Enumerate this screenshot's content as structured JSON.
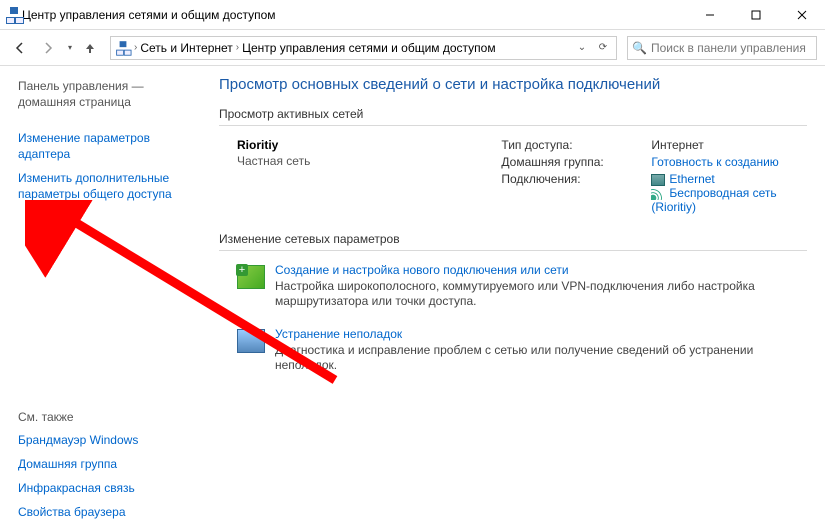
{
  "window": {
    "title": "Центр управления сетями и общим доступом"
  },
  "breadcrumb": {
    "level1": "Сеть и Интернет",
    "level2": "Центр управления сетями и общим доступом"
  },
  "search": {
    "placeholder": "Поиск в панели управления"
  },
  "sidebar": {
    "home": "Панель управления — домашняя страница",
    "adapter": "Изменение параметров адаптера",
    "advanced": "Изменить дополнительные параметры общего доступа",
    "seealso_label": "См. также",
    "seealso": {
      "firewall": "Брандмауэр Windows",
      "homegroup": "Домашняя группа",
      "infrared": "Инфракрасная связь",
      "browser": "Свойства браузера"
    }
  },
  "content": {
    "heading": "Просмотр основных сведений о сети и настройка подключений",
    "active_label": "Просмотр активных сетей",
    "network": {
      "name": "Rioritiy",
      "type": "Частная сеть",
      "access_label": "Тип доступа:",
      "access_value": "Интернет",
      "homegroup_label": "Домашняя группа:",
      "homegroup_value": "Готовность к созданию",
      "connections_label": "Подключения:",
      "conn_eth": "Ethernet",
      "conn_wifi": "Беспроводная сеть (Rioritiy)"
    },
    "change_label": "Изменение сетевых параметров",
    "new_conn": {
      "title": "Создание и настройка нового подключения или сети",
      "desc": "Настройка широкополосного, коммутируемого или VPN-подключения либо настройка маршрутизатора или точки доступа."
    },
    "troubleshoot": {
      "title": "Устранение неполадок",
      "desc": "Диагностика и исправление проблем с сетью или получение сведений об устранении неполадок."
    }
  }
}
